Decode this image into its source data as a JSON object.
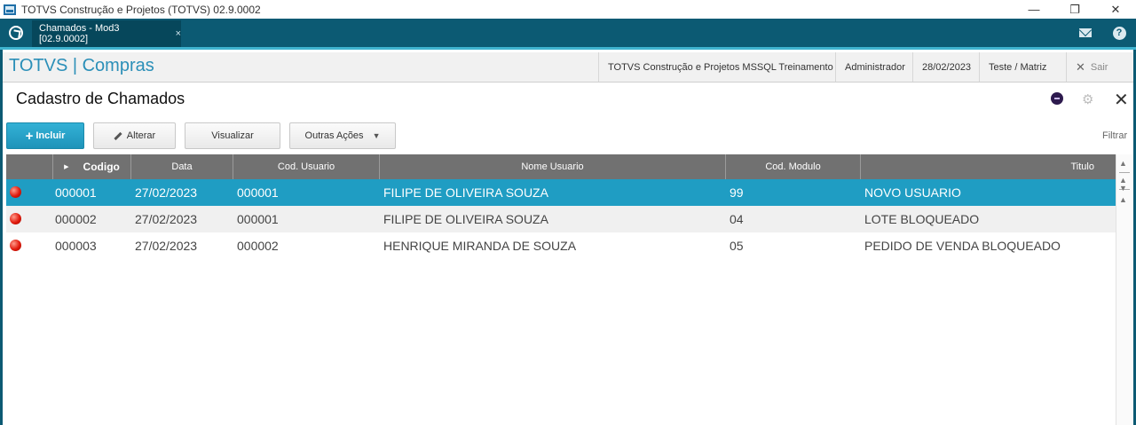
{
  "window": {
    "title": "TOTVS Construção e Projetos (TOTVS) 02.9.0002",
    "minimize": "—",
    "restore": "❐",
    "close": "✕"
  },
  "tabstrip": {
    "active_tab": "Chamados - Mod3 [02.9.0002]",
    "tab_close": "×",
    "help": "?"
  },
  "module": {
    "title": "TOTVS | Compras",
    "company": "TOTVS Construção e Projetos MSSQL Treinamento",
    "user": "Administrador",
    "date": "28/02/2023",
    "branch": "Teste / Matriz",
    "exit_icon": "✕",
    "exit_label": "Sair"
  },
  "page": {
    "title": "Cadastro de Chamados",
    "gear": "⚙",
    "close": "✕"
  },
  "toolbar": {
    "include_icon": "+",
    "include_label": "Incluir",
    "edit_label": "Alterar",
    "view_label": "Visualizar",
    "other_actions_label": "Outras Ações",
    "other_actions_caret": "▼",
    "filter_label": "Filtrar"
  },
  "grid": {
    "headers": {
      "indicator": "▶",
      "codigo": "Codigo",
      "data": "Data",
      "cod_usuario": "Cod. Usuario",
      "nome_usuario": "Nome Usuario",
      "cod_modulo": "Cod. Modulo",
      "titulo": "Titulo"
    },
    "rows": [
      {
        "codigo": "000001",
        "data": "27/02/2023",
        "cod_usuario": "000001",
        "nome_usuario": "FILIPE DE OLIVEIRA SOUZA",
        "cod_modulo": "99",
        "titulo": "NOVO USUARIO",
        "status_color": "#e11a0c"
      },
      {
        "codigo": "000002",
        "data": "27/02/2023",
        "cod_usuario": "000001",
        "nome_usuario": "FILIPE DE OLIVEIRA SOUZA",
        "cod_modulo": "04",
        "titulo": "LOTE BLOQUEADO",
        "status_color": "#e11a0c"
      },
      {
        "codigo": "000003",
        "data": "27/02/2023",
        "cod_usuario": "000002",
        "nome_usuario": "HENRIQUE MIRANDA DE SOUZA",
        "cod_modulo": "05",
        "titulo": "PEDIDO DE VENDA BLOQUEADO",
        "status_color": "#e11a0c"
      }
    ]
  },
  "scroll": {
    "up": "▲",
    "mid": "▲",
    "down": "▼",
    "bottom": "▲"
  },
  "colors": {
    "brand_dark": "#0c5a73",
    "accent": "#2b8fb8",
    "selected_row": "#1f9dc3",
    "header_gray": "#717171"
  }
}
